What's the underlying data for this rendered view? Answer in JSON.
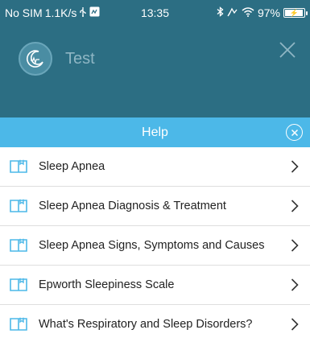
{
  "status_bar": {
    "carrier": "No SIM",
    "speed": "1.1K/s",
    "time": "13:35",
    "battery": "97%",
    "icons": [
      "usb-icon",
      "notification-icon",
      "bluetooth-icon",
      "alarm-icon",
      "wifi-icon",
      "battery-icon"
    ]
  },
  "header": {
    "app_title": "Test",
    "logo_icon": "moon-sleep-logo-icon",
    "close_icon": "close-icon"
  },
  "help_bar": {
    "title": "Help",
    "close_icon": "circle-close-icon"
  },
  "help_items": [
    {
      "label": "Sleep Apnea",
      "icon": "book-icon"
    },
    {
      "label": "Sleep Apnea Diagnosis & Treatment",
      "icon": "book-icon"
    },
    {
      "label": "Sleep Apnea Signs, Symptoms and Causes",
      "icon": "book-icon"
    },
    {
      "label": "Epworth Sleepiness Scale",
      "icon": "book-icon"
    },
    {
      "label": "What's Respiratory and Sleep Disorders?",
      "icon": "book-icon"
    }
  ],
  "colors": {
    "header_bg": "#2c6e83",
    "help_bar_bg": "#4cb8e8",
    "icon_accent": "#4cb8e8"
  }
}
